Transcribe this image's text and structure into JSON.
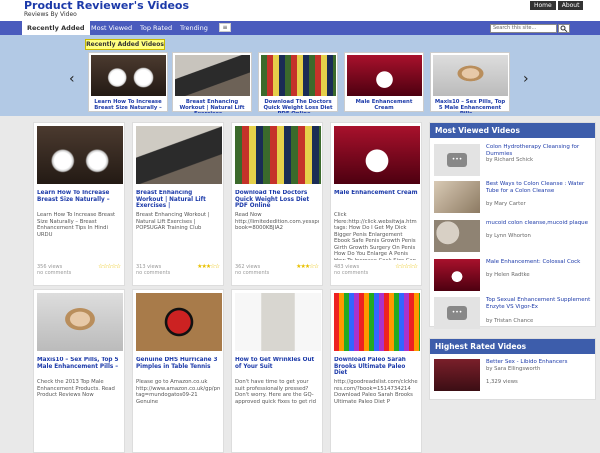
{
  "header": {
    "title": "Product Reviewer's Videos",
    "tagline": "Reviews By Video",
    "links": [
      "Home",
      "About"
    ]
  },
  "nav": {
    "items": [
      "Recently Added",
      "Most Viewed",
      "Top Rated",
      "Trending"
    ],
    "menu_icon": "≡",
    "search_placeholder": "Search this site...",
    "search_icon": "magnifier-icon"
  },
  "carousel": {
    "title": "Recently Added Videos",
    "prev": "‹",
    "next": "›",
    "slides": [
      "Learn How To Increase Breast Size Naturally – ...",
      "Breast Enhancing Workout | Natural Lift Exercises ...",
      "Download The Doctors Quick Weight Loss Diet PDF Online ...",
      "Male Enhancement Cream",
      "Maxis10 – Sex Pills, Top 5 Male Enhancement Pills ..."
    ]
  },
  "cards": [
    {
      "title": "Learn How To Increase Breast Size Naturally –",
      "desc": "Learn How To Increase Breast Size Naturally – Breast Enhancement Tips In Hindi URDU",
      "views": "356 views",
      "comments": "no comments",
      "stars": "☆☆☆☆☆"
    },
    {
      "title": "Breast Enhancing Workout | Natural Lift Exercises |",
      "desc": "Breast Enhancing Workout | Natural Lift Exercises | POPSUGAR Training Club",
      "views": "313 views",
      "comments": "no comments",
      "stars": "★★★☆☆"
    },
    {
      "title": "Download The Doctors Quick Weight Loss Diet PDF Online",
      "desc": "Read Now http://limitededition.com.yesspdf.com/?book=8000KBJIA2",
      "views": "362 views",
      "comments": "no comments",
      "stars": "★★★☆☆"
    },
    {
      "title": "Male Enhancement Cream",
      "desc": "Click Here:http://click.websitwja.htm tags: How Do I Get My Dick Bigger Penis Enlargement Ebook Safe Penis Growth Penis Girth Growth Surgery On Penis How Do You Enlarge A Penis How To Increase Cock Size Can You",
      "views": "483 views",
      "comments": "no comments",
      "stars": "☆☆☆☆☆"
    },
    {
      "title": "Maxis10 – Sex Pills, Top 5 Male Enhancement Pills –",
      "desc": "Check the 2013 Top Male Enhancement Products. Read Product Reviews Now",
      "views": "",
      "comments": "",
      "stars": ""
    },
    {
      "title": "Genuine DHS Hurricane 3 Pimples in Table Tennis",
      "desc": "Please go to Amazon.co.uk http://www.amazon.co.uk/gp/product/B0030CAZQY? tag=mundogatos09-21 Genuine",
      "views": "",
      "comments": "",
      "stars": ""
    },
    {
      "title": "How to Get Wrinkles Out of Your Suit",
      "desc": "Don't have time to get your suit professionally pressed? Don't worry. Here are the GQ-approved quick fixes to get rid",
      "views": "",
      "comments": "",
      "stars": ""
    },
    {
      "title": "Download Paleo Sarah Brooks Ultimate Paleo Diet",
      "desc": "http://goodreadslist.com/clckhe res.com/?book=1514734214 Download Paleo Sarah Brooks Ultimate Paleo Diet P",
      "views": "",
      "comments": "",
      "stars": ""
    }
  ],
  "sidebar": {
    "most_viewed_title": "Most Viewed Videos",
    "most_viewed": [
      {
        "title": "Colon Hydrotherapy Cleansing for Dummies",
        "by": "by Richard Schick"
      },
      {
        "title": "Best Ways to Colon Cleanse : Water Tube for a Colon Cleanse",
        "by": "by Mary Carter"
      },
      {
        "title": "mucoid colon cleanse,mucoid plaque",
        "by": "by Lynn Whorton"
      },
      {
        "title": "Male Enhancement: Colossal Cock",
        "by": "by Helen Radtke"
      },
      {
        "title": "Top Sexual Enhancement Supplement Enzyte VS Vigor-Ex",
        "by": "by Tristan Chance"
      }
    ],
    "highest_rated_title": "Highest Rated Videos",
    "highest_rated": [
      {
        "title": "Better Sex - Libido Enhancers",
        "by": "by Sara Ellingsworth",
        "views": "1,329 views"
      }
    ]
  }
}
